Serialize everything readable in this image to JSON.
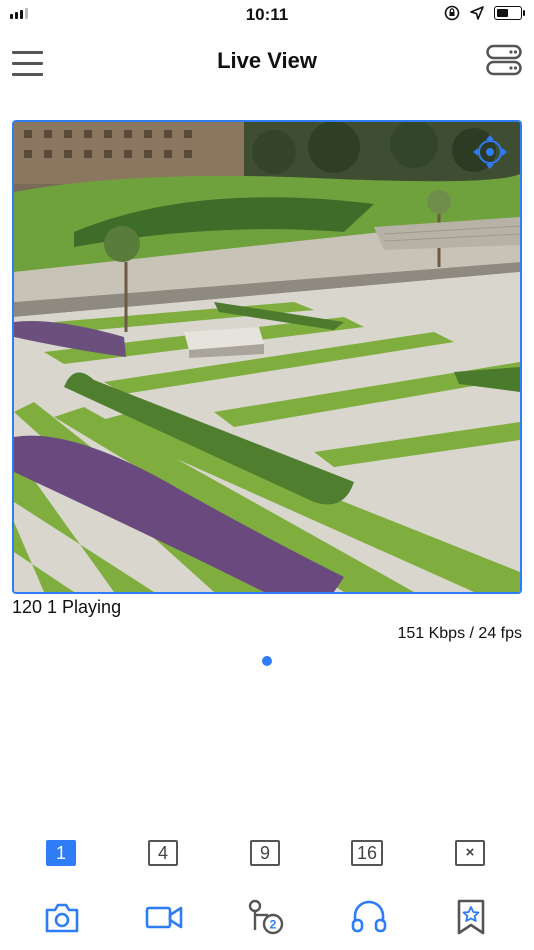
{
  "status_bar": {
    "time": "10:11",
    "icons": [
      "signal-icon",
      "rotation-lock-icon",
      "location-icon",
      "battery-icon"
    ]
  },
  "header": {
    "title": "Live View",
    "menu_icon": "menu-icon",
    "device_icon": "device-list-icon"
  },
  "video": {
    "camera_status": "120 1 Playing",
    "stream_stats": "151 Kbps / 24 fps",
    "ptz_icon": "ptz-control-icon",
    "page_count": 1,
    "current_page": 1
  },
  "layout_bar": {
    "options": [
      {
        "label": "1",
        "active": true
      },
      {
        "label": "4",
        "active": false
      },
      {
        "label": "9",
        "active": false
      },
      {
        "label": "16",
        "active": false
      },
      {
        "label": "×",
        "active": false
      }
    ]
  },
  "toolbar": {
    "items": [
      "snapshot-icon",
      "record-icon",
      "playback-icon",
      "audio-icon",
      "favorite-icon"
    ],
    "playback_badge": "2"
  },
  "colors": {
    "accent": "#2e7cf6",
    "icon": "#555555"
  }
}
